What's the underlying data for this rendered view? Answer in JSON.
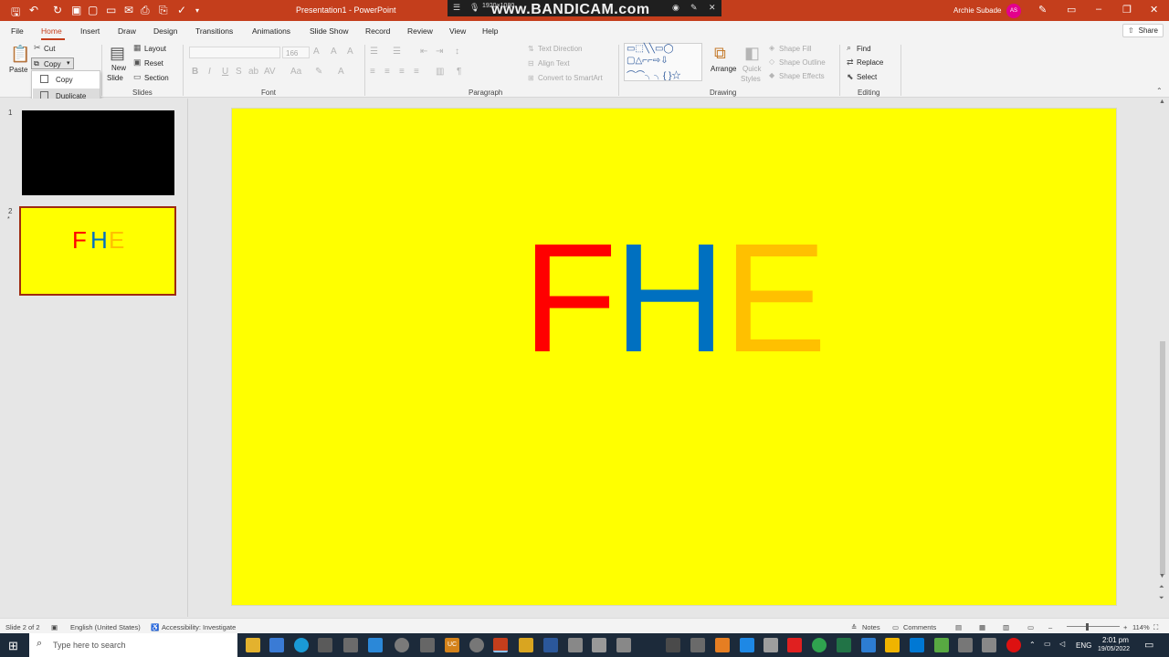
{
  "titlebar": {
    "title": "Presentation1  -  PowerPoint",
    "user_name": "Archie Subade",
    "user_initials": "AS",
    "accent_color": "#c43e1c"
  },
  "recorder": {
    "resolution": "1920×1080",
    "brand": "www.BANDICAM.com"
  },
  "tabs": [
    "File",
    "Home",
    "Insert",
    "Draw",
    "Design",
    "Transitions",
    "Animations",
    "Slide Show",
    "Record",
    "Review",
    "View",
    "Help"
  ],
  "share_label": "Share",
  "ribbon": {
    "clipboard": {
      "paste": "Paste",
      "cut": "Cut",
      "copy": "Copy"
    },
    "slides": {
      "new_slide_1": "New",
      "new_slide_2": "Slide",
      "layout": "Layout",
      "reset": "Reset",
      "section": "Section",
      "group": "Slides"
    },
    "font": {
      "group": "Font",
      "size": "166"
    },
    "paragraph": {
      "group": "Paragraph",
      "text_direction": "Text Direction",
      "align_text": "Align Text",
      "convert_smartart": "Convert to SmartArt"
    },
    "drawing": {
      "group": "Drawing",
      "arrange": "Arrange",
      "quick_styles_1": "Quick",
      "quick_styles_2": "Styles",
      "shape_fill": "Shape Fill",
      "shape_outline": "Shape Outline",
      "shape_effects": "Shape Effects"
    },
    "editing": {
      "group": "Editing",
      "find": "Find",
      "replace": "Replace",
      "select": "Select"
    }
  },
  "copy_menu": {
    "copy": "Copy",
    "duplicate": "Duplicate"
  },
  "thumbnails": [
    {
      "number": "1",
      "background": "#000000"
    },
    {
      "number": "2",
      "text": [
        "F",
        "H",
        "E"
      ]
    }
  ],
  "slide": {
    "background": "#ffff00",
    "letters": [
      {
        "char": "F",
        "color": "#ff0000"
      },
      {
        "char": "H",
        "color": "#0070c0"
      },
      {
        "char": "E",
        "color": "#ffc000"
      }
    ]
  },
  "statusbar": {
    "slide_count": "Slide 2 of 2",
    "language": "English (United States)",
    "accessibility": "Accessibility: Investigate",
    "notes": "Notes",
    "comments": "Comments",
    "zoom": "114%"
  },
  "taskbar": {
    "search_placeholder": "Type here to search",
    "language": "ENG",
    "time": "2:01 pm",
    "date": "19/05/2022",
    "uc_label": "UC"
  }
}
